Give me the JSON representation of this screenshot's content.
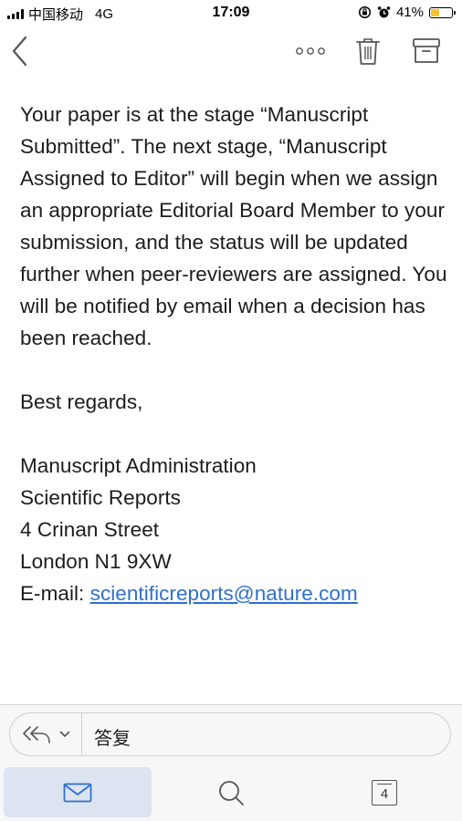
{
  "status_bar": {
    "carrier": "中国移动",
    "network": "4G",
    "time": "17:09",
    "battery": "41%",
    "battery_level": 0.41,
    "battery_color": "#f4c430",
    "icons": [
      "signal-icon",
      "orientation-lock-icon",
      "alarm-icon",
      "battery-icon"
    ]
  },
  "nav": {
    "icons": [
      "back-chevron-icon",
      "more-dots-icon",
      "trash-icon",
      "archive-icon"
    ]
  },
  "email": {
    "paragraph1": "Your paper is at the stage “Manuscript Submitted”. The next stage, “Manuscript Assigned to Editor” will begin when we assign an appropriate Editorial Board Member to your submission, and the status will be updated further when peer-reviewers are assigned. You will be notified by email when a decision has been reached.",
    "closing": "Best regards,",
    "signature": [
      "Manuscript Administration",
      "Scientific Reports",
      "4 Crinan Street",
      "London N1 9XW"
    ],
    "email_label": "E-mail: ",
    "email_address": "scientificreports@nature.com",
    "link_color": "#2f6fcf"
  },
  "reply_bar": {
    "reply_label": "答复",
    "icons": [
      "reply-all-icon",
      "chevron-down-icon"
    ]
  },
  "tab_bar": {
    "tabs": [
      {
        "name": "mail",
        "icon": "mail-icon",
        "active": true
      },
      {
        "name": "search",
        "icon": "search-icon",
        "active": false
      },
      {
        "name": "calendar",
        "icon": "calendar-icon",
        "badge": "4",
        "active": false
      }
    ],
    "active_color": "#dbe4f0",
    "accent_color": "#2f6fcf"
  }
}
